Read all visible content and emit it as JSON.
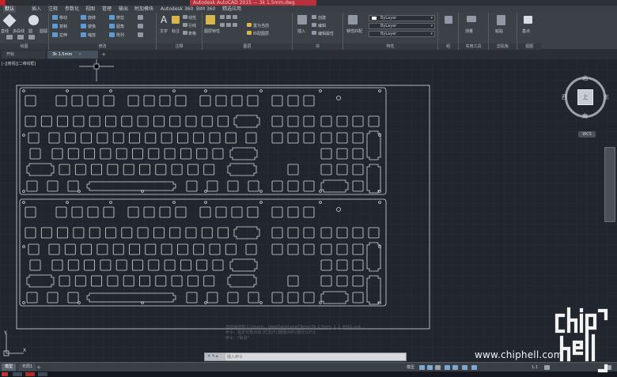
{
  "titlebar": {
    "title": "Autodesk AutoCAD 2015 — 3k 1.5mm.dwg"
  },
  "menu": {
    "tabs": [
      "默认",
      "插入",
      "注释",
      "参数化",
      "视图",
      "管理",
      "输出",
      "附加模块",
      "Autodesk 360",
      "BIM 360",
      "精选应用"
    ],
    "active_index": 0
  },
  "ribbon": {
    "panels": {
      "draw": "绘图",
      "modify": "修改",
      "annotation": "注释",
      "layers": "图层",
      "block": "块",
      "properties": "特性",
      "groups": "组",
      "utilities": "实用工具",
      "clipboard": "剪贴板",
      "view": "视图"
    },
    "draw_tools": [
      "直线",
      "多段线",
      "圆",
      "圆弧"
    ],
    "modify_tools": [
      "移动",
      "旋转",
      "修剪",
      "复制",
      "镜像",
      "圆角",
      "拉伸",
      "缩放",
      "阵列"
    ],
    "annotation_tools": [
      "文字",
      "标注",
      "线性",
      "引线",
      "表格"
    ],
    "layer_tools": [
      "图层特性",
      "置为当前",
      "匹配图层"
    ],
    "block_tools": [
      "插入",
      "创建",
      "编辑",
      "编辑属性"
    ],
    "properties_tools": [
      "特性匹配"
    ],
    "properties_values": {
      "color": "ByLayer",
      "linetype": "ByLayer",
      "lineweight": "ByLayer"
    },
    "utilities_tools": [
      "测量"
    ],
    "clipboard_tools": [
      "粘贴"
    ],
    "view_tools": [
      "基点"
    ]
  },
  "file_tabs": [
    {
      "label": "开始",
      "active": false
    },
    {
      "label": "3k 1.5mm",
      "active": true
    }
  ],
  "viewport_label": "[-][俯视][二维线框]",
  "viewcube": {
    "top": "上",
    "north": "北",
    "south": "南",
    "east": "东",
    "west": "西",
    "wcs": "WCS"
  },
  "ucs": {
    "x": "X",
    "y": "Y"
  },
  "command": {
    "history": [
      "自动保存到 C:\\Users\\...\\AppData\\Local\\Temp\\3k 1.5mm_1_1_4451.sv$ ...",
      "命令：指定对角点或 [栏选(F)/圈围(WP)/圈交(CP)]:",
      "命令：*取消*"
    ],
    "placeholder": "键入命令",
    "btns": "✕ ✎ ▸"
  },
  "layout_tabs": [
    {
      "label": "模型",
      "active": true
    },
    {
      "label": "布局1",
      "active": false
    }
  ],
  "statusbar": {
    "model": "模型",
    "scale": "1:1",
    "items": [
      "栅格",
      "捕捉",
      "正交",
      "极轴",
      "对象捕捉",
      "线宽",
      "注释比例"
    ]
  },
  "watermark": {
    "url": "www.chiphell.com",
    "logo": "chip hell"
  },
  "colors": {
    "background": "#21262e",
    "plate_outline": "#d6dbe0",
    "accent": "#c8202a"
  }
}
